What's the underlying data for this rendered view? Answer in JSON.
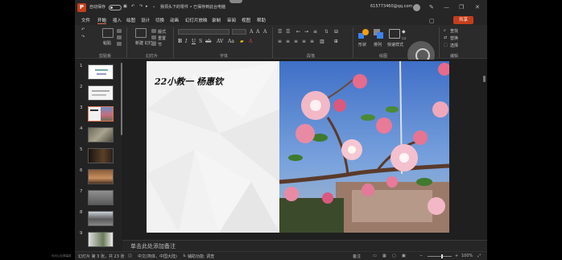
{
  "titlebar": {
    "autosave_label": "自动保存",
    "autosave_state": "关",
    "document_title": "我领头下的零件 • 已保存到此台电脑",
    "account": "615773460@qq.com",
    "app_icon": "powerpoint-icon"
  },
  "menu": {
    "items": [
      "文件",
      "开始",
      "插入",
      "绘图",
      "设计",
      "切换",
      "动画",
      "幻灯片放映",
      "录制",
      "审阅",
      "视图",
      "帮助"
    ],
    "active": "开始",
    "share_label": "共享"
  },
  "ribbon": {
    "clipboard_label": "剪贴板",
    "paste_label": "粘贴",
    "slides_label": "幻灯片",
    "new_slide_label": "新建\n幻灯片",
    "layout_label": "版式",
    "reset_label": "重置",
    "section_label": "节",
    "font_label": "字体",
    "paragraph_label": "段落",
    "drawing_label": "绘图",
    "shapes_label": "形状",
    "arrange_label": "排列",
    "quick_styles_label": "快速样式",
    "editing_label": "编辑",
    "find_label": "查找",
    "replace_label": "替换",
    "select_label": "选择",
    "dictation_label": "听写",
    "designer_label": "设计器",
    "voice_label": "语音",
    "more_label": "设计"
  },
  "thumbnails": {
    "numbers": [
      "1",
      "2",
      "3",
      "4",
      "5",
      "6",
      "7",
      "8",
      "9"
    ],
    "selected": "3"
  },
  "slide": {
    "title": "22小教一 杨惠钦"
  },
  "notes": {
    "placeholder": "单击此处添加备注"
  },
  "statusbar": {
    "slide_info": "幻灯片 第 3 张，共 23 张",
    "language": "中文(简体，中国大陆)",
    "accessibility": "辅助功能: 调查",
    "notes_label": "备注",
    "zoom": "100%",
    "zoom_fraction": 0.55
  },
  "outside": {
    "left_text": "你可以在屏幕录"
  },
  "colors": {
    "accent": "#c43e1c",
    "active_tab_underline": "#e07050"
  }
}
